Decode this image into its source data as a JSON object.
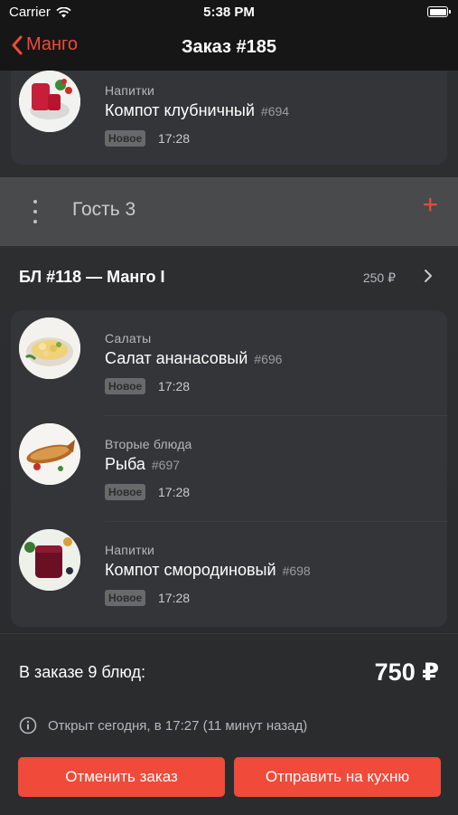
{
  "status_bar": {
    "carrier": "Carrier",
    "time": "5:38 PM"
  },
  "nav": {
    "back_label": "Манго",
    "title": "Заказ #185"
  },
  "first_card": {
    "items": [
      {
        "category": "Напитки",
        "name": "Компот клубничный",
        "id": "#694",
        "status": "Новое",
        "time": "17:28"
      }
    ]
  },
  "guest": {
    "name": "Гость 3",
    "add_label": "+"
  },
  "bill": {
    "title": "БЛ #118 — Манго I",
    "amount": "250 ₽"
  },
  "second_card": {
    "items": [
      {
        "category": "Салаты",
        "name": "Салат ананасовый",
        "id": "#696",
        "status": "Новое",
        "time": "17:28"
      },
      {
        "category": "Вторые блюда",
        "name": "Рыба",
        "id": "#697",
        "status": "Новое",
        "time": "17:28"
      },
      {
        "category": "Напитки",
        "name": "Компот смородиновый",
        "id": "#698",
        "status": "Новое",
        "time": "17:28"
      }
    ]
  },
  "footer": {
    "total_label": "В заказе 9 блюд:",
    "total_value": "750 ₽",
    "opened_text": "Открыт сегодня, в 17:27 (11 минут назад)",
    "cancel_label": "Отменить заказ",
    "send_label": "Отправить на кухню"
  },
  "colors": {
    "accent": "#f04a3a",
    "background": "#2a2c2e",
    "card": "#333538",
    "guest_bar": "#484a4c"
  },
  "icons": [
    "wifi-icon",
    "battery-icon",
    "chevron-left-icon",
    "more-vertical-icon",
    "plus-icon",
    "chevron-right-icon",
    "info-icon"
  ]
}
